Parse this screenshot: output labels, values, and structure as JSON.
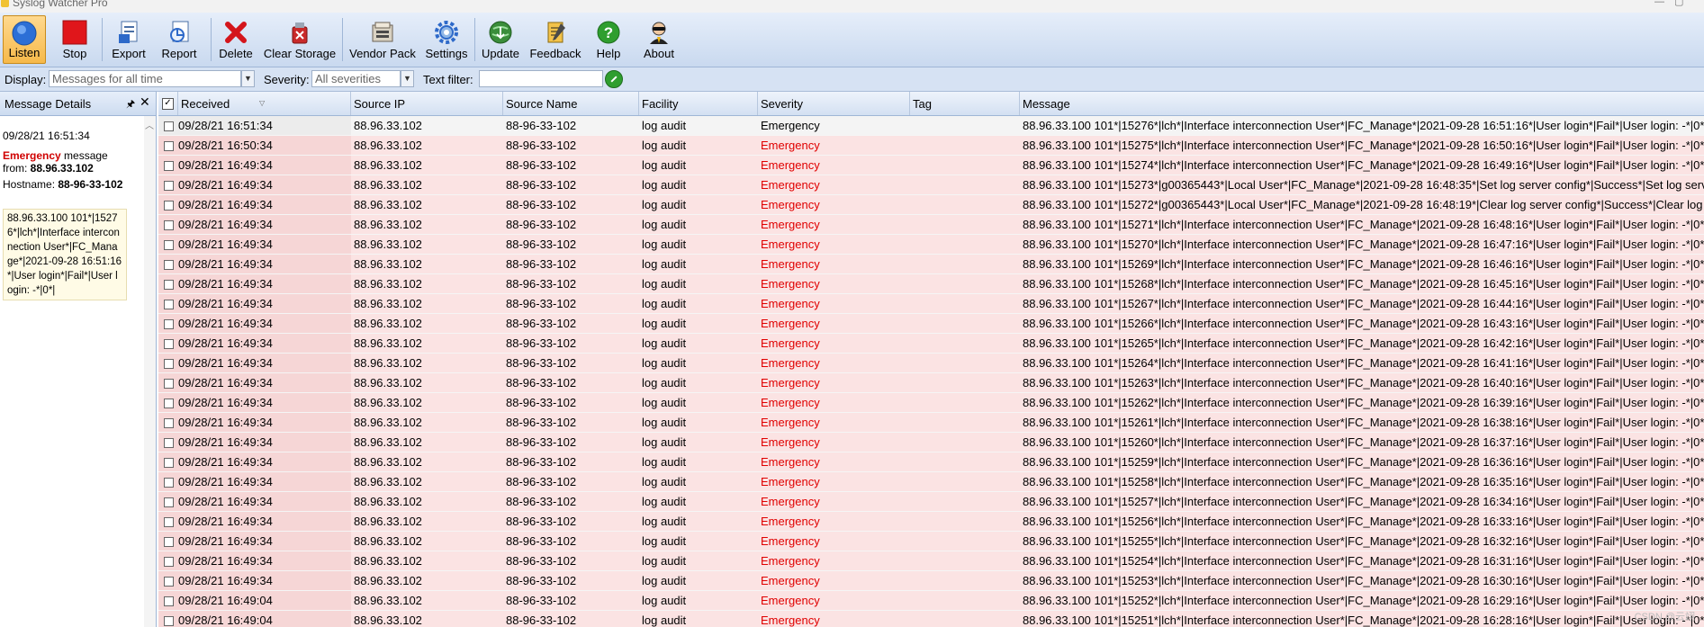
{
  "window": {
    "title": "Syslog Watcher Pro"
  },
  "toolbar": {
    "buttons": [
      {
        "label": "Listen",
        "icon": "listen-circle-icon"
      },
      {
        "label": "Stop",
        "icon": "stop-square-icon"
      },
      {
        "label": "Export",
        "icon": "export-document-icon"
      },
      {
        "label": "Report",
        "icon": "report-document-icon"
      },
      {
        "label": "Delete",
        "icon": "delete-x-icon"
      },
      {
        "label": "Clear Storage",
        "icon": "clear-storage-icon"
      },
      {
        "label": "Vendor Pack",
        "icon": "vendor-pack-icon"
      },
      {
        "label": "Settings",
        "icon": "settings-gear-icon"
      },
      {
        "label": "Update",
        "icon": "update-globe-icon"
      },
      {
        "label": "Feedback",
        "icon": "feedback-note-icon"
      },
      {
        "label": "Help",
        "icon": "help-question-icon"
      },
      {
        "label": "About",
        "icon": "about-agent-icon"
      }
    ],
    "active": "Listen"
  },
  "filters": {
    "display_label": "Display:",
    "display_value": "Messages for all time",
    "severity_label": "Severity:",
    "severity_value": "All severities",
    "text_filter_label": "Text filter:",
    "text_filter_value": ""
  },
  "message_details": {
    "header": "Message Details",
    "timestamp": "09/28/21 16:51:34",
    "severity": "Emergency",
    "message_word": " message",
    "from_word": "from: ",
    "from_ip": "88.96.33.102",
    "hostname_label": "Hostname: ",
    "hostname": "88-96-33-102",
    "message_text": "88.96.33.100 101*|15276*|lch*|Interface interconnection User*|FC_Manage*|2021-09-28 16:51:16*|User login*|Fail*|User login: -*|0*|"
  },
  "grid": {
    "columns": [
      "Received",
      "Source IP",
      "Source Name",
      "Facility",
      "Severity",
      "Tag",
      "Message"
    ],
    "rows": [
      {
        "received": "09/28/21 16:51:34",
        "ip": "88.96.33.102",
        "name": "88-96-33-102",
        "facility": "log audit",
        "severity": "Emergency",
        "tag": "",
        "message": "88.96.33.100 101*|15276*|lch*|Interface interconnection User*|FC_Manage*|2021-09-28 16:51:16*|User login*|Fail*|User login: -*|0*|"
      },
      {
        "received": "09/28/21 16:50:34",
        "ip": "88.96.33.102",
        "name": "88-96-33-102",
        "facility": "log audit",
        "severity": "Emergency",
        "tag": "",
        "message": "88.96.33.100 101*|15275*|lch*|Interface interconnection User*|FC_Manage*|2021-09-28 16:50:16*|User login*|Fail*|User login: -*|0*|"
      },
      {
        "received": "09/28/21 16:49:34",
        "ip": "88.96.33.102",
        "name": "88-96-33-102",
        "facility": "log audit",
        "severity": "Emergency",
        "tag": "",
        "message": "88.96.33.100 101*|15274*|lch*|Interface interconnection User*|FC_Manage*|2021-09-28 16:49:16*|User login*|Fail*|User login: -*|0*|"
      },
      {
        "received": "09/28/21 16:49:34",
        "ip": "88.96.33.102",
        "name": "88-96-33-102",
        "facility": "log audit",
        "severity": "Emergency",
        "tag": "",
        "message": "88.96.33.100 101*|15273*|g00365443*|Local User*|FC_Manage*|2021-09-28 16:48:35*|Set log server config*|Success*|Set log serv..."
      },
      {
        "received": "09/28/21 16:49:34",
        "ip": "88.96.33.102",
        "name": "88-96-33-102",
        "facility": "log audit",
        "severity": "Emergency",
        "tag": "",
        "message": "88.96.33.100 101*|15272*|g00365443*|Local User*|FC_Manage*|2021-09-28 16:48:19*|Clear log server config*|Success*|Clear log ..."
      },
      {
        "received": "09/28/21 16:49:34",
        "ip": "88.96.33.102",
        "name": "88-96-33-102",
        "facility": "log audit",
        "severity": "Emergency",
        "tag": "",
        "message": "88.96.33.100 101*|15271*|lch*|Interface interconnection User*|FC_Manage*|2021-09-28 16:48:16*|User login*|Fail*|User login: -*|0*|"
      },
      {
        "received": "09/28/21 16:49:34",
        "ip": "88.96.33.102",
        "name": "88-96-33-102",
        "facility": "log audit",
        "severity": "Emergency",
        "tag": "",
        "message": "88.96.33.100 101*|15270*|lch*|Interface interconnection User*|FC_Manage*|2021-09-28 16:47:16*|User login*|Fail*|User login: -*|0*|"
      },
      {
        "received": "09/28/21 16:49:34",
        "ip": "88.96.33.102",
        "name": "88-96-33-102",
        "facility": "log audit",
        "severity": "Emergency",
        "tag": "",
        "message": "88.96.33.100 101*|15269*|lch*|Interface interconnection User*|FC_Manage*|2021-09-28 16:46:16*|User login*|Fail*|User login: -*|0*|"
      },
      {
        "received": "09/28/21 16:49:34",
        "ip": "88.96.33.102",
        "name": "88-96-33-102",
        "facility": "log audit",
        "severity": "Emergency",
        "tag": "",
        "message": "88.96.33.100 101*|15268*|lch*|Interface interconnection User*|FC_Manage*|2021-09-28 16:45:16*|User login*|Fail*|User login: -*|0*|"
      },
      {
        "received": "09/28/21 16:49:34",
        "ip": "88.96.33.102",
        "name": "88-96-33-102",
        "facility": "log audit",
        "severity": "Emergency",
        "tag": "",
        "message": "88.96.33.100 101*|15267*|lch*|Interface interconnection User*|FC_Manage*|2021-09-28 16:44:16*|User login*|Fail*|User login: -*|0*|"
      },
      {
        "received": "09/28/21 16:49:34",
        "ip": "88.96.33.102",
        "name": "88-96-33-102",
        "facility": "log audit",
        "severity": "Emergency",
        "tag": "",
        "message": "88.96.33.100 101*|15266*|lch*|Interface interconnection User*|FC_Manage*|2021-09-28 16:43:16*|User login*|Fail*|User login: -*|0*|"
      },
      {
        "received": "09/28/21 16:49:34",
        "ip": "88.96.33.102",
        "name": "88-96-33-102",
        "facility": "log audit",
        "severity": "Emergency",
        "tag": "",
        "message": "88.96.33.100 101*|15265*|lch*|Interface interconnection User*|FC_Manage*|2021-09-28 16:42:16*|User login*|Fail*|User login: -*|0*|"
      },
      {
        "received": "09/28/21 16:49:34",
        "ip": "88.96.33.102",
        "name": "88-96-33-102",
        "facility": "log audit",
        "severity": "Emergency",
        "tag": "",
        "message": "88.96.33.100 101*|15264*|lch*|Interface interconnection User*|FC_Manage*|2021-09-28 16:41:16*|User login*|Fail*|User login: -*|0*|"
      },
      {
        "received": "09/28/21 16:49:34",
        "ip": "88.96.33.102",
        "name": "88-96-33-102",
        "facility": "log audit",
        "severity": "Emergency",
        "tag": "",
        "message": "88.96.33.100 101*|15263*|lch*|Interface interconnection User*|FC_Manage*|2021-09-28 16:40:16*|User login*|Fail*|User login: -*|0*|"
      },
      {
        "received": "09/28/21 16:49:34",
        "ip": "88.96.33.102",
        "name": "88-96-33-102",
        "facility": "log audit",
        "severity": "Emergency",
        "tag": "",
        "message": "88.96.33.100 101*|15262*|lch*|Interface interconnection User*|FC_Manage*|2021-09-28 16:39:16*|User login*|Fail*|User login: -*|0*|"
      },
      {
        "received": "09/28/21 16:49:34",
        "ip": "88.96.33.102",
        "name": "88-96-33-102",
        "facility": "log audit",
        "severity": "Emergency",
        "tag": "",
        "message": "88.96.33.100 101*|15261*|lch*|Interface interconnection User*|FC_Manage*|2021-09-28 16:38:16*|User login*|Fail*|User login: -*|0*|"
      },
      {
        "received": "09/28/21 16:49:34",
        "ip": "88.96.33.102",
        "name": "88-96-33-102",
        "facility": "log audit",
        "severity": "Emergency",
        "tag": "",
        "message": "88.96.33.100 101*|15260*|lch*|Interface interconnection User*|FC_Manage*|2021-09-28 16:37:16*|User login*|Fail*|User login: -*|0*|"
      },
      {
        "received": "09/28/21 16:49:34",
        "ip": "88.96.33.102",
        "name": "88-96-33-102",
        "facility": "log audit",
        "severity": "Emergency",
        "tag": "",
        "message": "88.96.33.100 101*|15259*|lch*|Interface interconnection User*|FC_Manage*|2021-09-28 16:36:16*|User login*|Fail*|User login: -*|0*|"
      },
      {
        "received": "09/28/21 16:49:34",
        "ip": "88.96.33.102",
        "name": "88-96-33-102",
        "facility": "log audit",
        "severity": "Emergency",
        "tag": "",
        "message": "88.96.33.100 101*|15258*|lch*|Interface interconnection User*|FC_Manage*|2021-09-28 16:35:16*|User login*|Fail*|User login: -*|0*|"
      },
      {
        "received": "09/28/21 16:49:34",
        "ip": "88.96.33.102",
        "name": "88-96-33-102",
        "facility": "log audit",
        "severity": "Emergency",
        "tag": "",
        "message": "88.96.33.100 101*|15257*|lch*|Interface interconnection User*|FC_Manage*|2021-09-28 16:34:16*|User login*|Fail*|User login: -*|0*|"
      },
      {
        "received": "09/28/21 16:49:34",
        "ip": "88.96.33.102",
        "name": "88-96-33-102",
        "facility": "log audit",
        "severity": "Emergency",
        "tag": "",
        "message": "88.96.33.100 101*|15256*|lch*|Interface interconnection User*|FC_Manage*|2021-09-28 16:33:16*|User login*|Fail*|User login: -*|0*|"
      },
      {
        "received": "09/28/21 16:49:34",
        "ip": "88.96.33.102",
        "name": "88-96-33-102",
        "facility": "log audit",
        "severity": "Emergency",
        "tag": "",
        "message": "88.96.33.100 101*|15255*|lch*|Interface interconnection User*|FC_Manage*|2021-09-28 16:32:16*|User login*|Fail*|User login: -*|0*|"
      },
      {
        "received": "09/28/21 16:49:34",
        "ip": "88.96.33.102",
        "name": "88-96-33-102",
        "facility": "log audit",
        "severity": "Emergency",
        "tag": "",
        "message": "88.96.33.100 101*|15254*|lch*|Interface interconnection User*|FC_Manage*|2021-09-28 16:31:16*|User login*|Fail*|User login: -*|0*|"
      },
      {
        "received": "09/28/21 16:49:34",
        "ip": "88.96.33.102",
        "name": "88-96-33-102",
        "facility": "log audit",
        "severity": "Emergency",
        "tag": "",
        "message": "88.96.33.100 101*|15253*|lch*|Interface interconnection User*|FC_Manage*|2021-09-28 16:30:16*|User login*|Fail*|User login: -*|0*|"
      },
      {
        "received": "09/28/21 16:49:04",
        "ip": "88.96.33.102",
        "name": "88-96-33-102",
        "facility": "log audit",
        "severity": "Emergency",
        "tag": "",
        "message": "88.96.33.100 101*|15252*|lch*|Interface interconnection User*|FC_Manage*|2021-09-28 16:29:16*|User login*|Fail*|User login: -*|0*|"
      },
      {
        "received": "09/28/21 16:49:04",
        "ip": "88.96.33.102",
        "name": "88-96-33-102",
        "facility": "log audit",
        "severity": "Emergency",
        "tag": "",
        "message": "88.96.33.100 101*|15251*|lch*|Interface interconnection User*|FC_Manage*|2021-09-28 16:28:16*|User login*|Fail*|User login: -*|0*|"
      }
    ]
  },
  "watermark": "CSDN @云翊",
  "colors": {
    "emergency": "#e00000",
    "row_bg": "#fbe3e3",
    "ribbon": "#c9d9ef"
  }
}
